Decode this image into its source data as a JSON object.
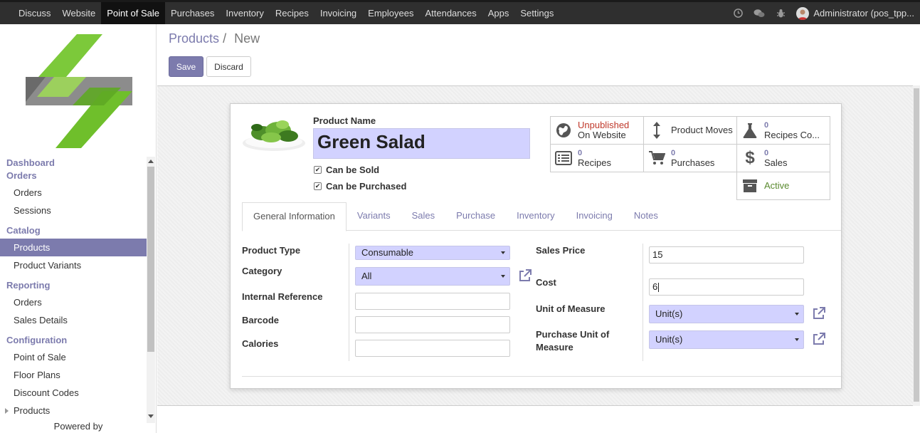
{
  "topbar": {
    "menu": [
      "Discuss",
      "Website",
      "Point of Sale",
      "Purchases",
      "Inventory",
      "Recipes",
      "Invoicing",
      "Employees",
      "Attendances",
      "Apps",
      "Settings"
    ],
    "active": "Point of Sale",
    "user": "Administrator (pos_tpp..."
  },
  "sidebar": {
    "sections": [
      {
        "title": "Dashboard",
        "items": []
      },
      {
        "title": "Orders",
        "items": [
          "Orders",
          "Sessions"
        ]
      },
      {
        "title": "Catalog",
        "items": [
          "Products",
          "Product Variants"
        ]
      },
      {
        "title": "Reporting",
        "items": [
          "Orders",
          "Sales Details"
        ]
      },
      {
        "title": "Configuration",
        "items": [
          "Point of Sale",
          "Floor Plans",
          "Discount Codes",
          "Products"
        ]
      }
    ],
    "active_item": "Products",
    "powered_by": "Powered by"
  },
  "breadcrumb": {
    "parent": "Products",
    "separator": "/",
    "current": "New"
  },
  "buttons": {
    "save": "Save",
    "discard": "Discard"
  },
  "product": {
    "name_label": "Product Name",
    "name": "Green Salad",
    "can_be_sold": "Can be Sold",
    "can_be_purchased": "Can be Purchased"
  },
  "stats": {
    "website_status": "Unpublished",
    "website_label": "On Website",
    "moves": "Product Moves",
    "recipes_count_num": "0",
    "recipes_count_label": "Recipes Co...",
    "recipes_num": "0",
    "recipes_label": "Recipes",
    "purchases_num": "0",
    "purchases_label": "Purchases",
    "sales_num": "0",
    "sales_label": "Sales",
    "active": "Active"
  },
  "tabs": [
    "General Information",
    "Variants",
    "Sales",
    "Purchase",
    "Inventory",
    "Invoicing",
    "Notes"
  ],
  "form": {
    "product_type_label": "Product Type",
    "product_type": "Consumable",
    "category_label": "Category",
    "category": "All",
    "internal_ref_label": "Internal Reference",
    "barcode_label": "Barcode",
    "calories_label": "Calories",
    "sales_price_label": "Sales Price",
    "sales_price": "15",
    "cost_label": "Cost",
    "cost": "6",
    "uom_label": "Unit of Measure",
    "uom": "Unit(s)",
    "purchase_uom_label": "Purchase Unit of Measure",
    "purchase_uom": "Unit(s)"
  },
  "colors": {
    "accent": "#7c7bad",
    "topbar": "#2f2f2f",
    "field": "#d2d2ff",
    "unpublished": "#c0392b",
    "active": "#5a8a2f"
  }
}
